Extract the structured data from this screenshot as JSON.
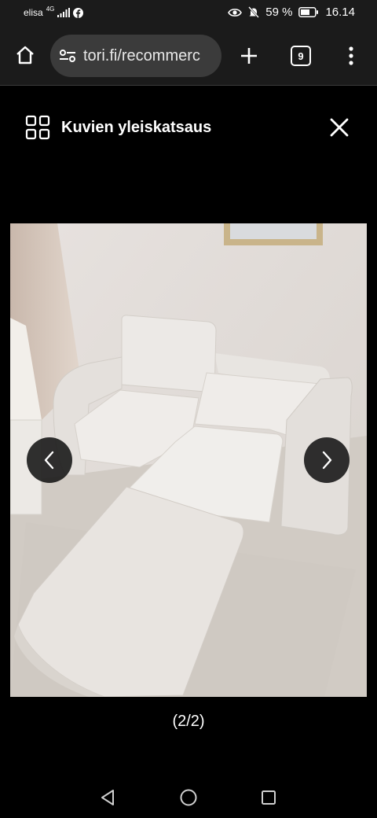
{
  "status": {
    "carrier": "elisa",
    "network": "4G",
    "battery": "59 %",
    "time": "16.14"
  },
  "browser": {
    "url": "tori.fi/recommerc",
    "tab_count": "9"
  },
  "viewer": {
    "title": "Kuvien yleiskatsaus",
    "counter": "(2/2)"
  },
  "icons": {
    "home": "home-icon",
    "site_settings": "tune-icon",
    "new_tab": "plus-icon",
    "more": "more-vert-icon",
    "grid": "grid-icon",
    "close": "close-icon",
    "prev": "chevron-left-icon",
    "next": "chevron-right-icon"
  }
}
